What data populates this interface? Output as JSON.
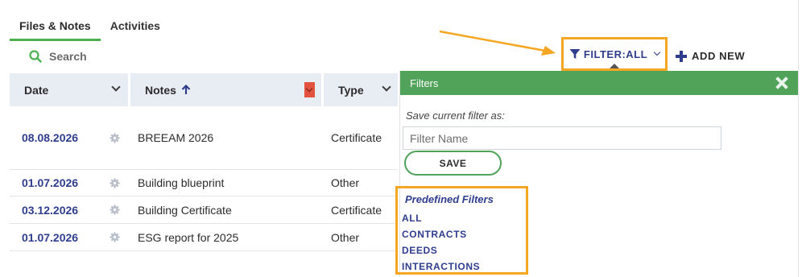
{
  "tabs": [
    {
      "label": "Files & Notes",
      "active": true
    },
    {
      "label": "Activities",
      "active": false
    }
  ],
  "search": {
    "label": "Search",
    "icon": "search-icon"
  },
  "table": {
    "columns": [
      {
        "label": "Date"
      },
      {
        "label": "Notes"
      },
      {
        "label": "Type"
      }
    ],
    "rows": [
      {
        "date": "08.08.2026",
        "note": "BREEAM 2026",
        "type": "Certificate"
      },
      {
        "date": "01.07.2026",
        "note": "Building blueprint",
        "type": "Other"
      },
      {
        "date": "03.12.2026",
        "note": "Building Certificate",
        "type": "Certificate"
      },
      {
        "date": "01.07.2026",
        "note": "ESG report for 2025",
        "type": "Other"
      }
    ]
  },
  "toolbar": {
    "filter_label": "FILTER:ALL",
    "add_new_label": "ADD NEW"
  },
  "filters_panel": {
    "title": "Filters",
    "save_as_label": "Save current filter as:",
    "name_placeholder": "Filter Name",
    "save_button": "SAVE",
    "predefined_title": "Predefined Filters",
    "predefined": [
      "ALL",
      "CONTRACTS",
      "DEEDS",
      "INTERACTIONS"
    ]
  },
  "colors": {
    "accent_green": "#52a35a",
    "link_blue": "#2f3d8c",
    "highlight_orange": "#f5a623",
    "header_bg": "#e8edf4",
    "sort_marker_red": "#e2533f"
  }
}
